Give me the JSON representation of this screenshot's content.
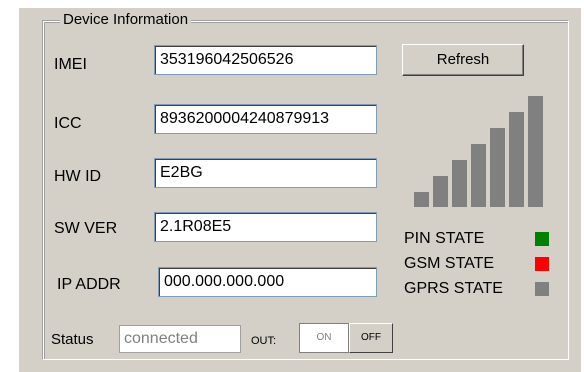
{
  "group": {
    "title": "Device Information"
  },
  "fields": {
    "imei": {
      "label": "IMEI",
      "value": "353196042506526"
    },
    "icc": {
      "label": "ICC",
      "value": "8936200004240879913"
    },
    "hwid": {
      "label": "HW ID",
      "value": "E2BG"
    },
    "swver": {
      "label": "SW VER",
      "value": "2.1R08E5"
    },
    "ipaddr": {
      "label": "IP ADDR",
      "value": "000.000.000.000"
    }
  },
  "refresh_label": "Refresh",
  "signal": {
    "levels_total": 7,
    "levels_active": 7,
    "bar_color": "#808080"
  },
  "states": [
    {
      "label": "PIN STATE",
      "color": "#008000"
    },
    {
      "label": "GSM STATE",
      "color": "#ff0000"
    },
    {
      "label": "GPRS STATE",
      "color": "#808080"
    }
  ],
  "status": {
    "label": "Status",
    "value": "connected"
  },
  "out": {
    "label": "OUT:",
    "on_label": "ON",
    "off_label": "OFF",
    "selected": "ON"
  }
}
